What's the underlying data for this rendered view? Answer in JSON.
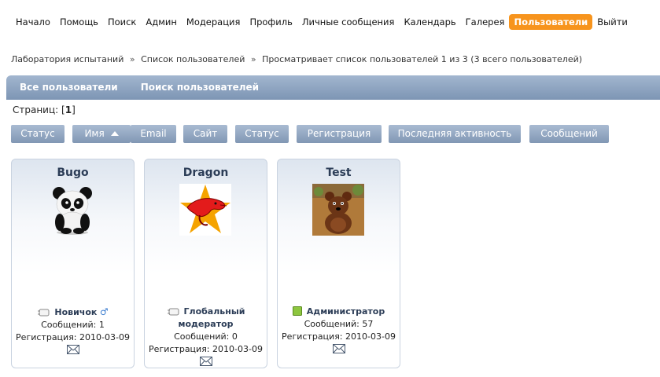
{
  "nav": [
    {
      "label": "Начало"
    },
    {
      "label": "Помощь"
    },
    {
      "label": "Поиск"
    },
    {
      "label": "Админ"
    },
    {
      "label": "Модерация"
    },
    {
      "label": "Профиль"
    },
    {
      "label": "Личные сообщения"
    },
    {
      "label": "Календарь"
    },
    {
      "label": "Галерея"
    },
    {
      "label": "Пользователи",
      "active": true
    },
    {
      "label": "Выйти"
    }
  ],
  "breadcrumb": {
    "items": [
      "Лаборатория испытаний",
      "Список пользователей",
      "Просматривает список пользователей 1 из 3 (3 всего пользователей)"
    ],
    "separator": "»"
  },
  "tabs": [
    "Все пользователи",
    "Поиск пользователей"
  ],
  "pages": {
    "label": "Страниц:",
    "current": "1"
  },
  "sort_buttons": [
    "Статус",
    "Имя",
    "Email",
    "Сайт",
    "Статус",
    "Регистрация",
    "Последняя активность",
    "Сообщений"
  ],
  "colors": {
    "accent": "#f7941d",
    "bar": "#8ba1bf",
    "online": "#8dc63f"
  },
  "members": [
    {
      "name": "Bugo",
      "rank": "Новичок",
      "gender": "male",
      "posts_label": "Сообщений: 1",
      "reg_label": "Регистрация: 2010-03-09",
      "online": false,
      "avatar": "panda-avatar"
    },
    {
      "name": "Dragon",
      "rank": "Глобальный модератор",
      "posts_label": "Сообщений: 0",
      "reg_label": "Регистрация: 2010-03-09",
      "online": false,
      "avatar": "dragon-star-avatar"
    },
    {
      "name": "Test",
      "rank": "Администратор",
      "posts_label": "Сообщений: 57",
      "reg_label": "Регистрация: 2010-03-09",
      "online": true,
      "avatar": "bear-avatar"
    }
  ]
}
